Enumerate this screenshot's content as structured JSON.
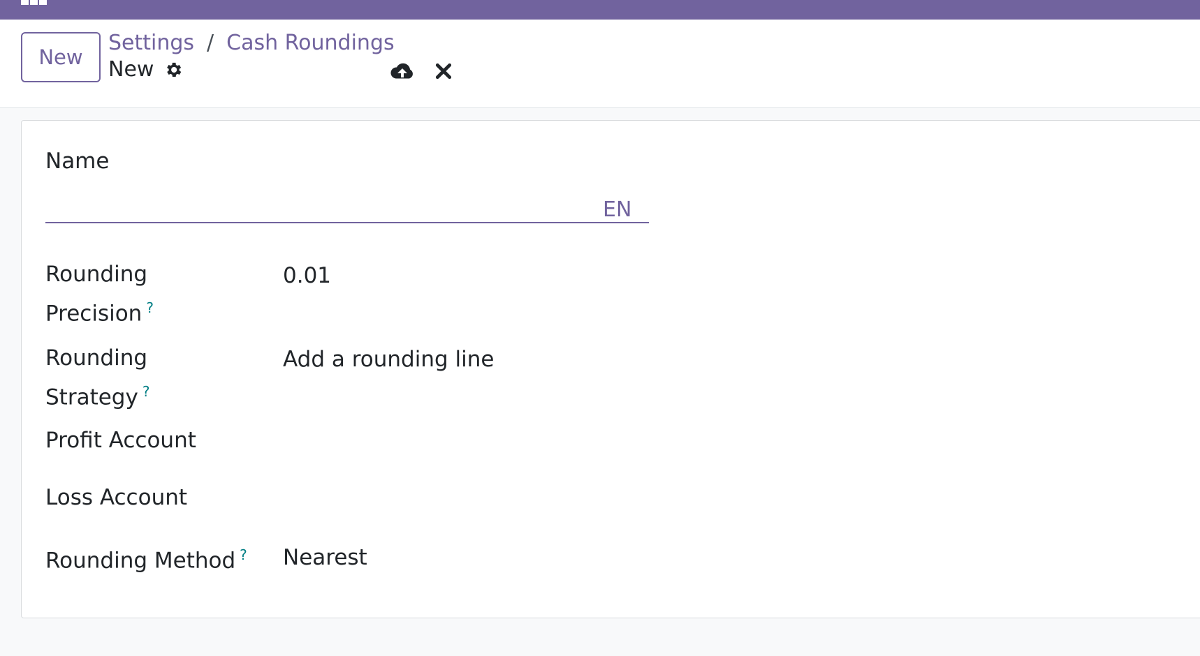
{
  "topbar": {
    "apps_icon": "apps-grid-icon",
    "menu_strip": "· · · · · · · ·"
  },
  "control_panel": {
    "new_button_label": "New",
    "breadcrumb": {
      "parent": "Settings",
      "separator": "/",
      "current": "Cash Roundings"
    },
    "record_title": "New",
    "icons": {
      "gear": "gear-icon",
      "save": "cloud-upload-icon",
      "discard": "close-icon"
    }
  },
  "form": {
    "name": {
      "label": "Name",
      "value": "",
      "lang_button": "EN"
    },
    "rounding_precision": {
      "label_line1": "Rounding",
      "label_line2": "Precision",
      "help": "?",
      "value": "0.01"
    },
    "rounding_strategy": {
      "label_line1": "Rounding",
      "label_line2": "Strategy",
      "help": "?",
      "value": "Add a rounding line"
    },
    "profit_account": {
      "label": "Profit Account",
      "value": ""
    },
    "loss_account": {
      "label": "Loss Account",
      "value": ""
    },
    "rounding_method": {
      "label": "Rounding Method",
      "help": "?",
      "value": "Nearest"
    }
  },
  "colors": {
    "brand": "#71639e",
    "help": "#017e84",
    "background": "#f8f9fa"
  }
}
